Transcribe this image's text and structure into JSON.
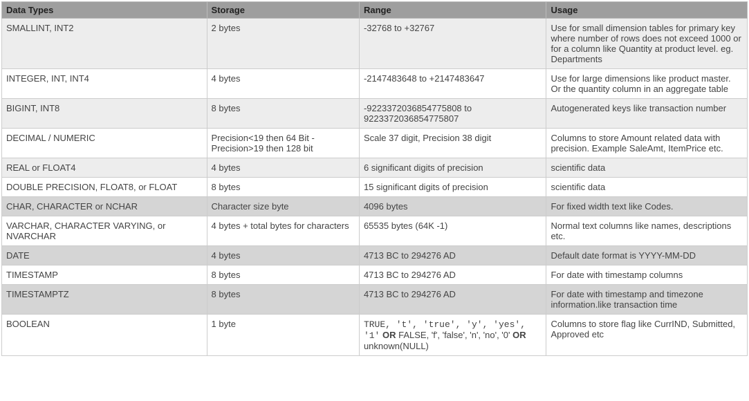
{
  "headers": {
    "c0": "Data Types",
    "c1": "Storage",
    "c2": "Range",
    "c3": "Usage"
  },
  "rows": [
    {
      "cls": "light",
      "dt": "SMALLINT, INT2",
      "st": "2 bytes",
      "rg": "-32768 to +32767",
      "us": "Use for small dimension tables for primary key where number of rows does not exceed 1000 or for a column like Quantity at product level. eg. Departments"
    },
    {
      "cls": "white",
      "dt": "INTEGER, INT, INT4",
      "st": "4 bytes",
      "rg": "-2147483648 to +2147483647",
      "us": "Use for large dimensions like product master. Or the quantity column in an aggregate table"
    },
    {
      "cls": "light",
      "dt": "BIGINT, INT8",
      "st": "8 bytes",
      "rg": "-9223372036854775808 to 9223372036854775807",
      "us": "Autogenerated keys like transaction number"
    },
    {
      "cls": "white",
      "dt": "DECIMAL / NUMERIC",
      "st": "Precision<19 then 64 Bit - Precision>19 then 128 bit",
      "rg": "Scale 37 digit, Precision 38 digit",
      "us": "Columns to store Amount related data with precision. Example SaleAmt, ItemPrice etc."
    },
    {
      "cls": "light",
      "dt": "REAL or FLOAT4",
      "st": "4 bytes",
      "rg": "6 significant digits of precision",
      "us": "scientific data"
    },
    {
      "cls": "white",
      "dt": "DOUBLE PRECISION, FLOAT8, or FLOAT",
      "st": "8 bytes",
      "rg": "15 significant digits of precision",
      "us": "scientific data"
    },
    {
      "cls": "mid",
      "dt": "CHAR, CHARACTER or NCHAR",
      "st": "Character size byte",
      "rg": "4096 bytes",
      "us": "For fixed width text like Codes."
    },
    {
      "cls": "white",
      "dt": "VARCHAR, CHARACTER VARYING, or NVARCHAR",
      "st": "4 bytes + total bytes for characters",
      "rg": "65535 bytes (64K -1)",
      "us": "Normal text columns like names, descriptions etc."
    },
    {
      "cls": "mid",
      "dt": "DATE",
      "st": "4 bytes",
      "rg": "4713 BC to 294276 AD",
      "us": "Default date format is YYYY-MM-DD"
    },
    {
      "cls": "white",
      "dt": "TIMESTAMP",
      "st": "8 bytes",
      "rg": "4713 BC to 294276 AD",
      "us": "For date with timestamp columns"
    },
    {
      "cls": "mid",
      "dt": "TIMESTAMPTZ",
      "st": "8 bytes",
      "rg": "4713 BC to 294276 AD",
      "us": "For date with timestamp and timezone information.like transaction time"
    },
    {
      "cls": "white",
      "dt": "BOOLEAN",
      "st": "1 byte",
      "rg_html": "<span class='mono'>TRUE, 't', 'true', 'y', 'yes', '1'</span> <strong>OR</strong> FALSE, 'f', 'false', 'n', 'no', '0' <strong>OR</strong> unknown(NULL)",
      "us": "Columns to store flag like CurrIND, Submitted, Approved etc"
    }
  ]
}
